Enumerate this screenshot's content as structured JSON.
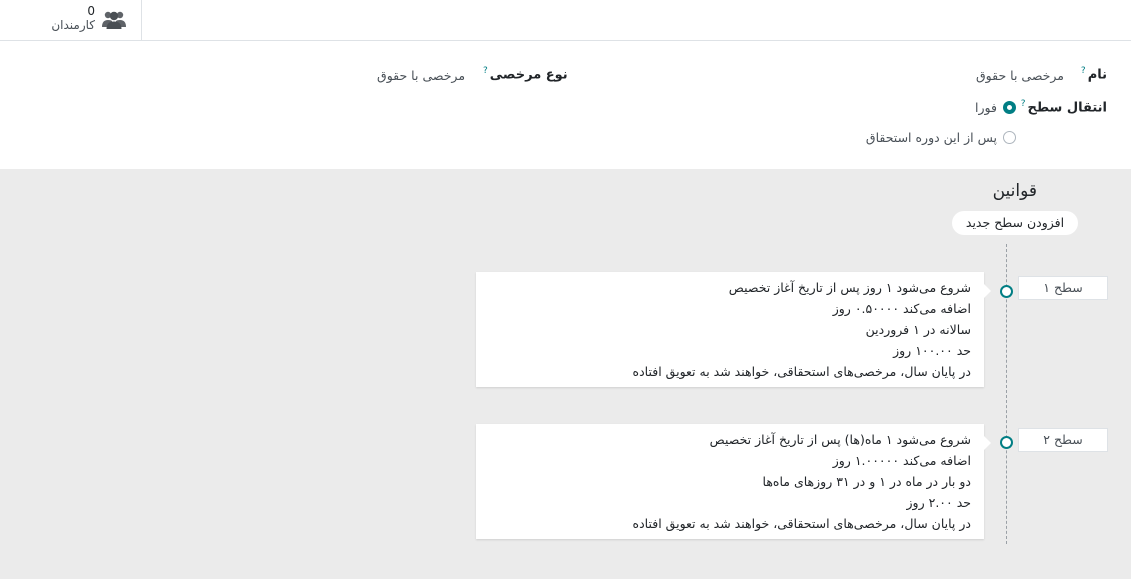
{
  "stat_button": {
    "count": "0",
    "label": "کارمندان",
    "icon": "users-icon"
  },
  "form": {
    "name_label": "نام",
    "name_value": "مرخصی با حقوق",
    "leave_type_label": "نوع مرخصی",
    "leave_type_value": "مرخصی با حقوق",
    "transition_label": "انتقال سطح",
    "help_mark": "?",
    "options": [
      {
        "label": "فورا",
        "checked": true
      },
      {
        "label": "پس از این دوره استحقاق",
        "checked": false
      }
    ]
  },
  "rules": {
    "title": "قوانین",
    "add_button": "افزودن سطح جدید",
    "levels": [
      {
        "tag": "سطح ۱",
        "lines": [
          "شروع می‌شود ۱ روز پس از تاریخ آغاز تخصیص",
          "اضافه می‌کند ۰.۵۰۰۰۰ روز",
          "سالانه در ۱ فروردین",
          "حد ۱۰۰.۰۰ روز",
          "در پایان سال، مرخصی‌های استحقاقی، خواهند شد به تعویق افتاده"
        ]
      },
      {
        "tag": "سطح ۲",
        "lines": [
          "شروع می‌شود ۱ ماه(ها) پس از تاریخ آغاز تخصیص",
          "اضافه می‌کند ۱.۰۰۰۰۰ روز",
          "دو بار در ماه در ۱ و در ۳۱ روزهای ماه‌ها",
          "حد ۲.۰۰ روز",
          "در پایان سال، مرخصی‌های استحقاقی، خواهند شد به تعویق افتاده"
        ]
      }
    ]
  },
  "colors": {
    "accent": "#017e84",
    "grey_bg": "#ebebeb"
  }
}
